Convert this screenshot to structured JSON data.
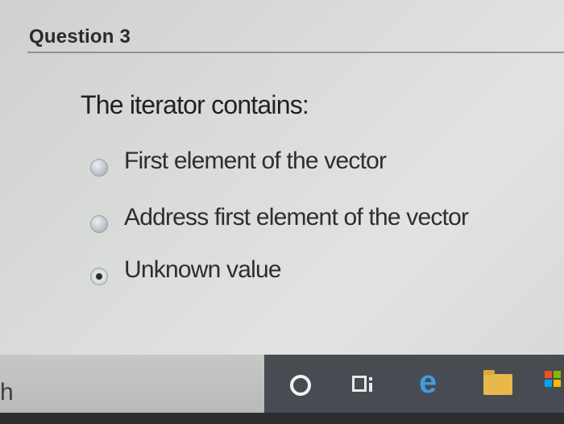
{
  "question": {
    "title": "Question 3",
    "prompt": "The iterator contains:",
    "options": [
      {
        "label": "First element of the vector",
        "selected": false
      },
      {
        "label": "Address first element of the vector",
        "selected": false
      },
      {
        "label": "Unknown value",
        "selected": true
      }
    ]
  },
  "edge_text": "h",
  "taskbar": {
    "icons": [
      "cortana-icon",
      "task-view-icon",
      "edge-icon",
      "file-explorer-icon",
      "store-icon"
    ],
    "edge_glyph": "e"
  },
  "colors": {
    "taskbar": "#474b52",
    "edge_blue": "#3f9be0",
    "folder_yellow": "#e8b94a"
  }
}
